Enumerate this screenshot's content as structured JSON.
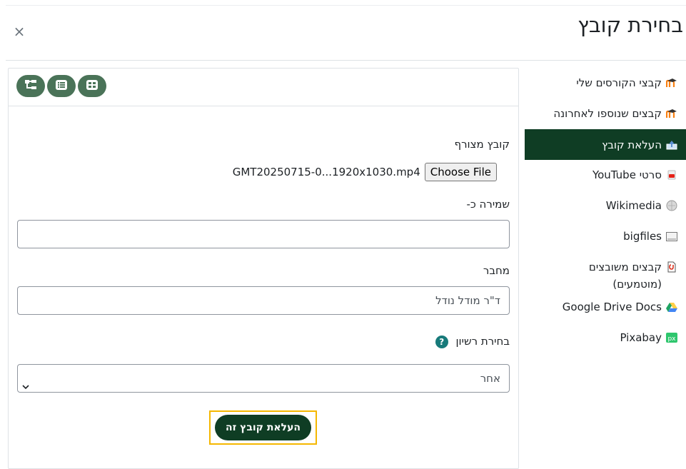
{
  "dialog": {
    "title": "בחירת קובץ",
    "close_glyph": "×"
  },
  "sidebar": {
    "items": [
      {
        "label": "קבצי הקורסים שלי",
        "icon": "moodle-icon"
      },
      {
        "label": "קבצים שנוספו לאחרונה",
        "icon": "moodle-icon"
      },
      {
        "label": "העלאת קובץ",
        "icon": "upload-icon",
        "active": true
      },
      {
        "label": "סרטי YouTube",
        "icon": "youtube-icon"
      },
      {
        "label": "Wikimedia",
        "icon": "wikimedia-icon"
      },
      {
        "label": "bigfiles",
        "icon": "bigfiles-icon"
      },
      {
        "label": "קבצים משובצים (מוטמעים)",
        "icon": "embedded-files-icon"
      },
      {
        "label": "Google Drive Docs",
        "icon": "google-drive-icon"
      },
      {
        "label": "Pixabay",
        "icon": "pixabay-icon"
      }
    ]
  },
  "toolbar": {
    "views": [
      "tree-view-icon",
      "list-view-icon",
      "grid-view-icon"
    ]
  },
  "form": {
    "attachment_label": "קובץ מצורף",
    "choose_file_label": "Choose File",
    "file_name": "GMT20250715-0...1920x1030.mp4",
    "save_as_label": "שמירה כ-",
    "save_as_value": "",
    "author_label": "מחבר",
    "author_value": "ד\"ר מודל נודל",
    "license_label": "בחירת רשיון",
    "license_help": "?",
    "license_value": "אחר",
    "upload_button": "העלאת קובץ זה"
  },
  "colors": {
    "accent": "#0f3d24",
    "toolbar_button": "#4a7358",
    "focus": "#f5b700"
  }
}
